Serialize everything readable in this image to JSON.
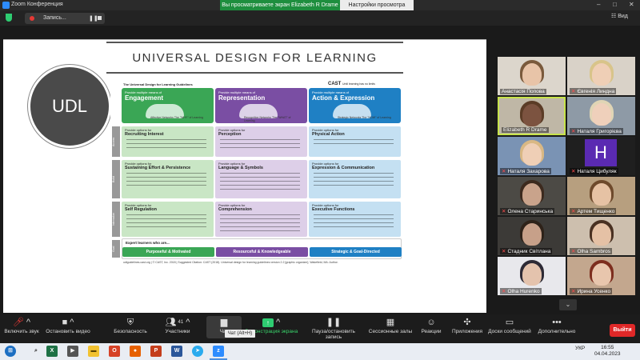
{
  "window": {
    "title": "Zoom Конференция",
    "share_banner": "Вы просматриваете экран Elizabeth R Drame",
    "view_options": "Настройки просмотра",
    "controls": [
      "–",
      "□",
      "✕"
    ]
  },
  "recording": {
    "label": "Запись...",
    "view_label": "☷ Вид"
  },
  "slide": {
    "title": "UNIVERSAL DESIGN FOR LEARNING",
    "badge": "UDL",
    "guide": {
      "top_label": "The Universal Design for Learning Guidelines",
      "publisher": "CAST",
      "publisher_tag": "Until learning has no limits",
      "columns": [
        {
          "sub": "Provide multiple means of",
          "title": "Engagement",
          "network": "Affective Networks The \"WHY\" of Learning",
          "color": "#3aa655"
        },
        {
          "sub": "Provide multiple means of",
          "title": "Representation",
          "network": "Recognition Networks The \"WHAT\" of Learning",
          "color": "#7a4ea3"
        },
        {
          "sub": "Provide multiple means of",
          "title": "Action & Expression",
          "network": "Strategic Networks The \"HOW\" of Learning",
          "color": "#1f80c4"
        }
      ],
      "rows": [
        {
          "tag": "Access",
          "cells": [
            "Recruiting Interest",
            "Perception",
            "Physical Action"
          ]
        },
        {
          "tag": "Build",
          "cells": [
            "Sustaining Effort & Persistence",
            "Language & Symbols",
            "Expression & Communication"
          ]
        },
        {
          "tag": "Internalize",
          "cells": [
            "Self Regulation",
            "Comprehension",
            "Executive Functions"
          ]
        }
      ],
      "cell_sub": "Provide options for",
      "expert_title": "Expert learners who are...",
      "outcomes": [
        "Purposeful & Motivated",
        "Resourceful & Knowledgeable",
        "Strategic & Goal-Directed"
      ],
      "goal_tag": "Goal",
      "footer": "udlguidelines.cast.org | © CAST, Inc. 2018 | Suggested Citation: CAST (2018). Universal design for learning guidelines version 2.2 [graphic organizer]. Wakefield, MA: Author."
    }
  },
  "participants": [
    {
      "name": "Анастасія Попова",
      "muted": false
    },
    {
      "name": "Євгенія Линдна",
      "muted": true
    },
    {
      "name": "Elizabeth R Drame",
      "muted": false
    },
    {
      "name": "Наталя Григорієва",
      "muted": true
    },
    {
      "name": "Наталя Захарова",
      "muted": true
    },
    {
      "name": "Наталя Цибуляк",
      "muted": true,
      "initial": "H"
    },
    {
      "name": "Олена Старинська",
      "muted": true
    },
    {
      "name": "Артем Тищенко",
      "muted": true
    },
    {
      "name": "Стадник Світлана",
      "muted": true
    },
    {
      "name": "Olha Sambros",
      "muted": true
    },
    {
      "name": "Olha Hurenko",
      "muted": true
    },
    {
      "name": "Ирина Усенко",
      "muted": true
    }
  ],
  "toolbar": {
    "unmute": "Включить звук",
    "stop_video": "Остановить видео",
    "security": "Безопасность",
    "participants": "Участники",
    "participants_count": "41",
    "chat": "Чат",
    "chat_tooltip": "Чат (Alt+H)",
    "share": "Демонстрация экрана",
    "pause_recording": "Пауза/остановить запись",
    "breakout": "Сессионные залы",
    "reactions": "Реакции",
    "apps": "Приложения",
    "whiteboard": "Доски сообщений",
    "more": "Дополнительно",
    "leave": "Выйти"
  },
  "taskbar": {
    "lang": "УКР",
    "time": "16:55",
    "date": "04.04.2023"
  }
}
